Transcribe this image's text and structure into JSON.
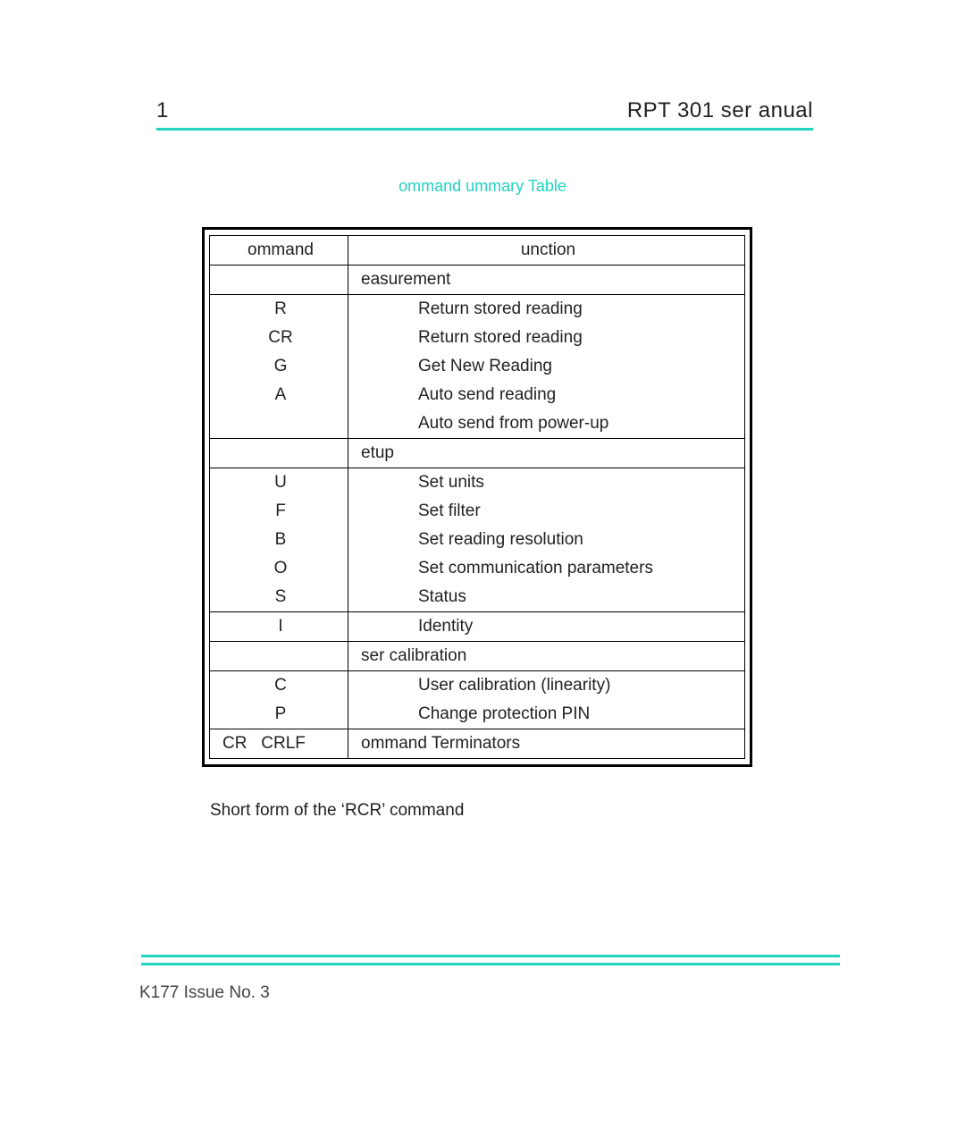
{
  "header": {
    "page_number": "1",
    "title": "RPT 301 ser anual"
  },
  "caption": "ommand ummary Table",
  "table": {
    "head": {
      "command": "ommand",
      "function": "unction"
    },
    "sections": {
      "measurement": "easurement",
      "setup": "etup",
      "user_cal": "ser calibration",
      "terminators": "ommand Terminators"
    },
    "rows": {
      "r": {
        "cmd": "R",
        "func": "Return stored reading"
      },
      "cr": {
        "cmd": "CR",
        "func": "Return stored reading"
      },
      "g": {
        "cmd": "G",
        "func": "Get New Reading"
      },
      "a": {
        "cmd": "A",
        "func": "Auto send reading"
      },
      "apu": {
        "cmd": "",
        "func": "Auto send from power-up"
      },
      "u": {
        "cmd": "U",
        "func": "Set units"
      },
      "f": {
        "cmd": "F",
        "func": "Set filter"
      },
      "b": {
        "cmd": "B",
        "func": "Set reading resolution"
      },
      "o": {
        "cmd": "O",
        "func": "Set communication parameters"
      },
      "s": {
        "cmd": "S",
        "func": "Status"
      },
      "i": {
        "cmd": "I",
        "func": "Identity"
      },
      "c": {
        "cmd": "C",
        "func": "User calibration (linearity)"
      },
      "p": {
        "cmd": "P",
        "func": "Change protection PIN"
      },
      "term": {
        "cmd": "CR   CRLF"
      }
    }
  },
  "note": "Short form of the ‘RCR’ command",
  "footer": "K177 Issue No. 3",
  "colors": {
    "accent": "#21d2c0"
  }
}
